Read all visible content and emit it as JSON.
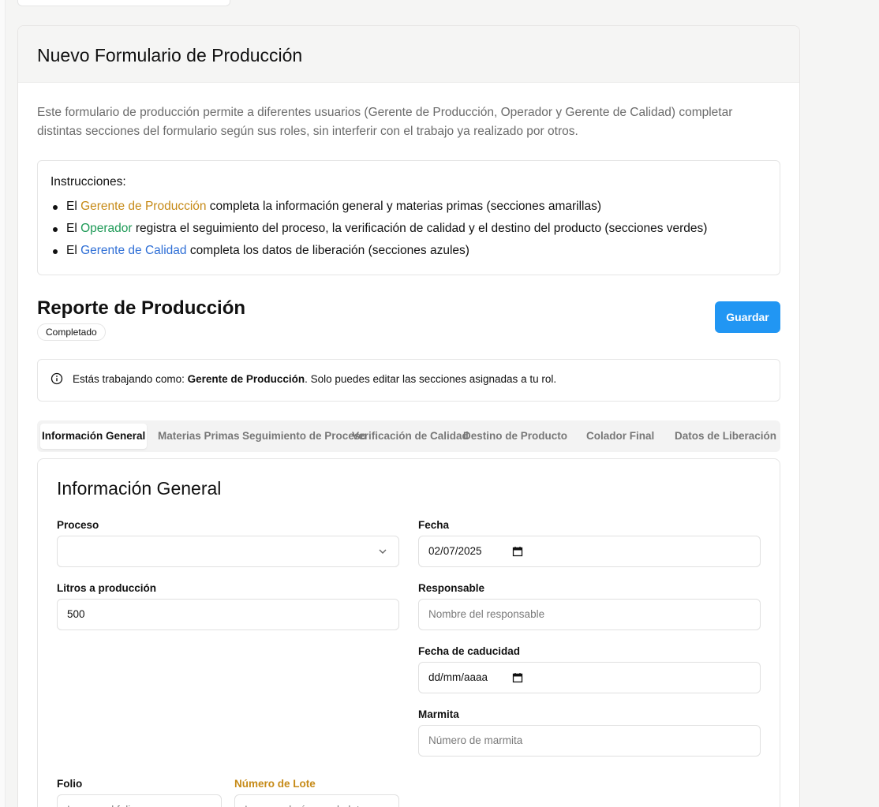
{
  "page": {
    "title": "Nuevo Formulario de Producción",
    "description": "Este formulario de producción permite a diferentes usuarios (Gerente de Producción, Operador y Gerente de Calidad) completar distintas secciones del formulario según sus roles, sin interferir con el trabajo ya realizado por otros."
  },
  "instructions": {
    "title": "Instrucciones:",
    "items": [
      {
        "prefix": "El ",
        "role": "Gerente de Producción",
        "text": " completa la información general y materias primas (secciones amarillas)",
        "color": "#c68a17"
      },
      {
        "prefix": "El ",
        "role": "Operador",
        "text": " registra el seguimiento del proceso, la verificación de calidad y el destino del producto (secciones verdes)",
        "color": "#1e9a57"
      },
      {
        "prefix": "El ",
        "role": "Gerente de Calidad",
        "text": " completa los datos de liberación (secciones azules)",
        "color": "#2f6fd6"
      }
    ]
  },
  "report": {
    "title": "Reporte de Producción",
    "status": "Completado",
    "save_label": "Guardar"
  },
  "alert": {
    "prefix": "Estás trabajando como: ",
    "role": "Gerente de Producción",
    "suffix": ". Solo puedes editar las secciones asignadas a tu rol."
  },
  "tabs": [
    {
      "label": "Información General",
      "active": true
    },
    {
      "label": "Materias Primas"
    },
    {
      "label": "Seguimiento de Proceso"
    },
    {
      "label": "Verificación de Calidad"
    },
    {
      "label": "Destino de Producto"
    },
    {
      "label": "Colador Final"
    },
    {
      "label": "Datos de Liberación"
    }
  ],
  "section": {
    "title": "Información General",
    "fields": {
      "proceso": {
        "label": "Proceso",
        "value": ""
      },
      "fecha": {
        "label": "Fecha",
        "value": "02/07/2025"
      },
      "litros": {
        "label": "Litros a producción",
        "value": "500"
      },
      "responsable": {
        "label": "Responsable",
        "placeholder": "Nombre del responsable"
      },
      "caducidad": {
        "label": "Fecha de caducidad",
        "value": "dd/mm/aaaa"
      },
      "marmita": {
        "label": "Marmita",
        "placeholder": "Número de marmita"
      },
      "folio": {
        "label": "Folio",
        "placeholder": "Ingrese el folio"
      },
      "lote": {
        "label": "Número de Lote",
        "placeholder": "Ingrese el número de lote"
      }
    }
  },
  "colors": {
    "accent": "#2196f3",
    "production_role": "#c68a17",
    "operator_role": "#1e9a57",
    "quality_role": "#2f6fd6"
  }
}
